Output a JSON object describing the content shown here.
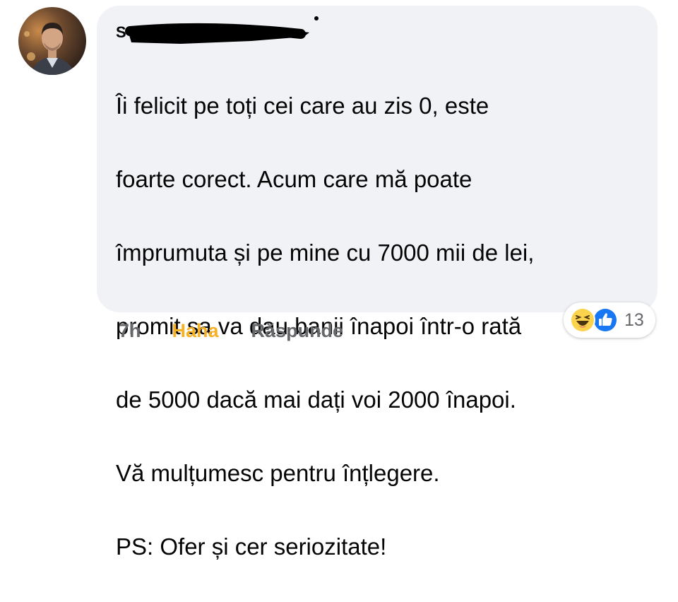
{
  "comment": {
    "author_name": "S",
    "lines": [
      "Îi felicit pe toți cei care au zis 0, este",
      "foarte corect. Acum care mă poate",
      "împrumuta și pe mine cu 7000 mii de lei,",
      "promit sa va dau banii înapoi într-o rată",
      "de 5000 dacă mai dați voi 2000 înapoi.",
      "Vă mulțumesc pentru înțlegere.",
      "PS: Ofer și cer seriozitate!"
    ]
  },
  "actions": {
    "time": "7h",
    "haha_label": "Haha",
    "reply_label": "Răspunde"
  },
  "reactions": {
    "icons": [
      "haha-icon",
      "like-icon"
    ],
    "count": "13"
  },
  "colors": {
    "bubble": "#f0f2f5",
    "haha_text": "#f7b125",
    "muted_text": "#65676b",
    "like_blue": "#1877f2",
    "haha_yellow": "#fcd34d"
  }
}
